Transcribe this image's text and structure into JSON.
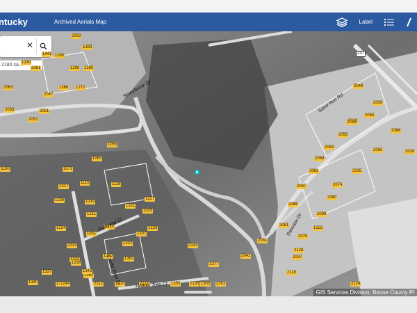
{
  "header": {
    "brand": "ntucky",
    "map_title": "Archived Aerials Map",
    "label_button": "Label"
  },
  "search": {
    "value": "2180 sa..."
  },
  "parcels": [
    "1261",
    "1267",
    "1242",
    "1260",
    "1230",
    "1265",
    "1268",
    "2061",
    "1266",
    "1272",
    "2063",
    "2047",
    "2033",
    "2051",
    "2052",
    "1055",
    "1063",
    "1180",
    "1071",
    "1115",
    "1118",
    "1226",
    "1317",
    "1319",
    "1224",
    "1211",
    "1210",
    "1227",
    "1325",
    "1229",
    "1207",
    "2213",
    "1221",
    "1331",
    "1222",
    "1224",
    "1333",
    "1336",
    "1340",
    "1337",
    "1363",
    "1362",
    "1364",
    "2221",
    "1377",
    "1343",
    "2244",
    "2112",
    "1370",
    "1355",
    "1355",
    "2135",
    "2201",
    "2133",
    "2119",
    "2128",
    "1322",
    "2099",
    "2081",
    "2075",
    "2086",
    "2087",
    "2080",
    "2074",
    "2069",
    "2083",
    "2062",
    "2056",
    "2066",
    "2050",
    "2035",
    "2043",
    "2055",
    "2039",
    "2049",
    "2038",
    "2041",
    "2031",
    "2037",
    "2028",
    "2124",
    "2093",
    "1383",
    "1441"
  ],
  "streets": {
    "s1": "Stonybrook Dr",
    "s2": "Sand Run Rd",
    "s3": "Parkview Ct",
    "s4": "Hollow Tree Ct",
    "s5": "Treeview Dr",
    "s6": "Castle View Dr",
    "route": "237"
  },
  "credit": "GIS Services Division, Boone County Pl"
}
